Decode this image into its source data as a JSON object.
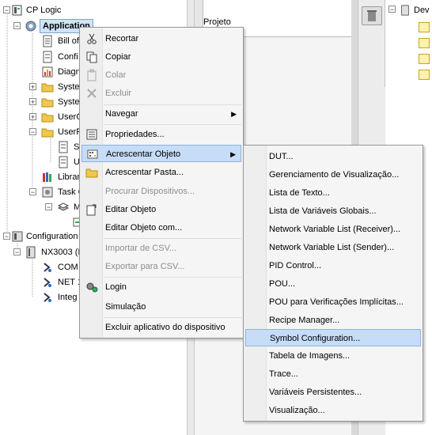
{
  "tree": {
    "items": [
      {
        "label": "CP Logic"
      },
      {
        "label": "Application"
      },
      {
        "label": "Bill of"
      },
      {
        "label": "Confi"
      },
      {
        "label": "Diagn"
      },
      {
        "label": "Syste"
      },
      {
        "label": "Syste"
      },
      {
        "label": "UserG"
      },
      {
        "label": "UserP"
      },
      {
        "label": "S"
      },
      {
        "label": "U"
      },
      {
        "label": "Librar"
      },
      {
        "label": "Task C"
      },
      {
        "label": "M"
      },
      {
        "label": "Configuration"
      },
      {
        "label": "NX3003 (N"
      },
      {
        "label": "COM"
      },
      {
        "label": "NET 1"
      },
      {
        "label": "Integ"
      }
    ]
  },
  "mid_panel": {
    "label": "Projeto"
  },
  "right_panel": {
    "header": "Dev"
  },
  "context_menu": {
    "items": [
      {
        "label": "Recortar",
        "icon": "scissors-icon",
        "disabled": false
      },
      {
        "label": "Copiar",
        "icon": "copy-icon",
        "disabled": false
      },
      {
        "label": "Colar",
        "icon": "paste-icon",
        "disabled": true
      },
      {
        "label": "Excluir",
        "icon": "delete-icon",
        "disabled": true
      },
      {
        "label": "Navegar",
        "submenu": true,
        "disabled": false
      },
      {
        "label": "Propriedades...",
        "icon": "properties-icon",
        "disabled": false
      },
      {
        "label": "Acrescentar Objeto",
        "icon": "add-object-icon",
        "submenu": true,
        "highlighted": true,
        "disabled": false
      },
      {
        "label": "Acrescentar Pasta...",
        "icon": "folder-icon",
        "disabled": false
      },
      {
        "label": "Procurar Dispositivos...",
        "disabled": true
      },
      {
        "label": "Editar Objeto",
        "icon": "edit-object-icon",
        "disabled": false
      },
      {
        "label": "Editar Objeto com...",
        "disabled": false
      },
      {
        "label": "Importar de CSV...",
        "disabled": true
      },
      {
        "label": "Exportar para CSV...",
        "disabled": true
      },
      {
        "label": "Login",
        "icon": "login-icon",
        "disabled": false
      },
      {
        "label": "Simulação",
        "disabled": false
      },
      {
        "label": "Excluir aplicativo do dispositivo",
        "disabled": false
      }
    ]
  },
  "submenu": {
    "items": [
      {
        "label": "DUT..."
      },
      {
        "label": "Gerenciamento de Visualização..."
      },
      {
        "label": "Lista de Texto..."
      },
      {
        "label": "Lista de Variáveis Globais..."
      },
      {
        "label": "Network Variable List (Receiver)..."
      },
      {
        "label": "Network Variable List (Sender)..."
      },
      {
        "label": "PID Control..."
      },
      {
        "label": "POU..."
      },
      {
        "label": "POU para Verificações Implícitas..."
      },
      {
        "label": "Recipe Manager..."
      },
      {
        "label": "Symbol Configuration...",
        "highlighted": true
      },
      {
        "label": "Tabela de Imagens..."
      },
      {
        "label": "Trace..."
      },
      {
        "label": "Variáveis Persistentes..."
      },
      {
        "label": "Visualização..."
      }
    ]
  },
  "colors": {
    "highlight": "#c6dcf7",
    "selection": "#cfe3fb",
    "folder": "#f0c84a"
  }
}
